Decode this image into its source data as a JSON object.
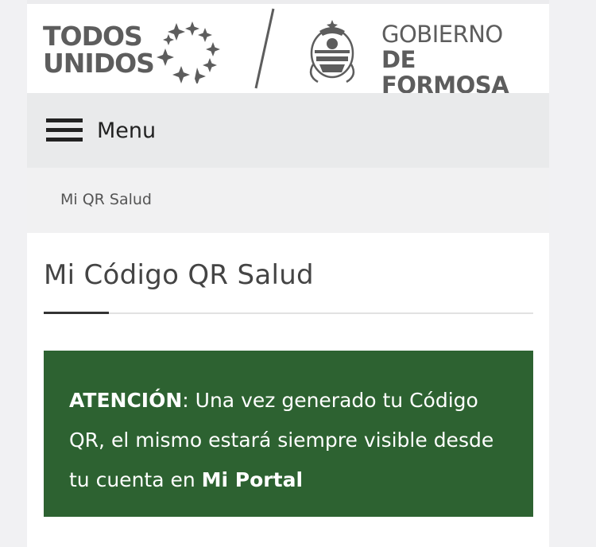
{
  "header": {
    "brand_line1": "TODOS",
    "brand_line2": "UNIDOS",
    "gov_line1": "GOBIERNO",
    "gov_line2": "DE FORMOSA",
    "logo_icon": "stars-icon",
    "shield_icon": "formosa-shield-icon"
  },
  "menu": {
    "label": "Menu",
    "icon": "hamburger-icon"
  },
  "breadcrumb": {
    "current": "Mi QR Salud"
  },
  "page": {
    "title": "Mi Código QR Salud"
  },
  "alert": {
    "label": "ATENCIÓN",
    "message": ": Una vez generado tu Código QR, el mismo estará siempre visible desde tu cuenta en ",
    "link_text": "Mi Portal",
    "background": "#2d6231"
  },
  "colors": {
    "menu_bar": "#e9eaeb",
    "breadcrumb_bar": "#f1f1f2",
    "brand_text": "#5d5d5d"
  }
}
